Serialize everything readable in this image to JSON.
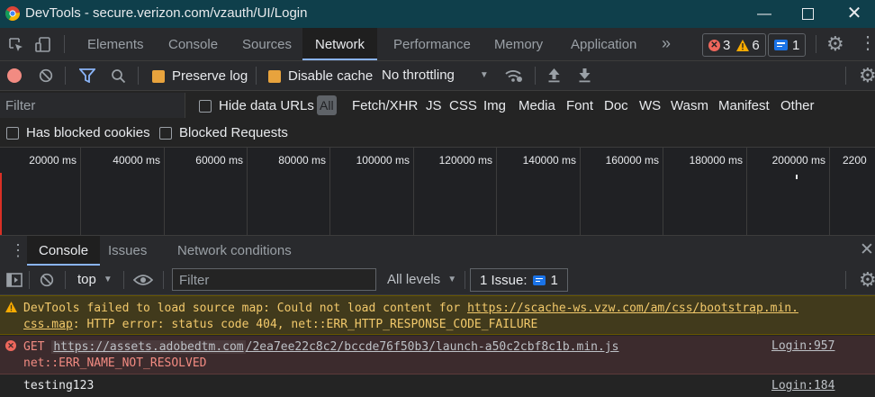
{
  "window": {
    "title": "DevTools - secure.verizon.com/vzauth/UI/Login"
  },
  "tabs": [
    {
      "label": "Elements"
    },
    {
      "label": "Console"
    },
    {
      "label": "Sources"
    },
    {
      "label": "Network"
    },
    {
      "label": "Performance"
    },
    {
      "label": "Memory"
    },
    {
      "label": "Application"
    }
  ],
  "badges": {
    "errors": "3",
    "warnings": "6",
    "messages": "1"
  },
  "network_toolbar": {
    "preserve_log": "Preserve log",
    "disable_cache": "Disable cache",
    "throttling": "No throttling"
  },
  "filter_row": {
    "placeholder": "Filter",
    "hide_data_urls": "Hide data URLs",
    "types": [
      "All",
      "Fetch/XHR",
      "JS",
      "CSS",
      "Img",
      "Media",
      "Font",
      "Doc",
      "WS",
      "Wasm",
      "Manifest",
      "Other"
    ]
  },
  "blocked_row": {
    "has_blocked_cookies": "Has blocked cookies",
    "blocked_requests": "Blocked Requests"
  },
  "timeline": {
    "ticks": [
      "20000 ms",
      "40000 ms",
      "60000 ms",
      "80000 ms",
      "100000 ms",
      "120000 ms",
      "140000 ms",
      "160000 ms",
      "180000 ms",
      "200000 ms",
      "2200"
    ]
  },
  "drawer": {
    "tabs": [
      {
        "label": "Console"
      },
      {
        "label": "Issues"
      },
      {
        "label": "Network conditions"
      }
    ]
  },
  "console_toolbar": {
    "context": "top",
    "filter_placeholder": "Filter",
    "levels": "All levels",
    "issues_label": "1 Issue:",
    "issues_count": "1"
  },
  "messages": {
    "warning": {
      "text_a": "DevTools failed to load source map: Could not load content for ",
      "link_a": "https://scache-ws.vzw.com/am/css/bootstrap.min.",
      "link_b": "css.map",
      "text_b": ": HTTP error: status code 404, net::ERR_HTTP_RESPONSE_CODE_FAILURE"
    },
    "error": {
      "method": "GET ",
      "url_host": "https://assets.adobedtm.com",
      "url_path": "/2ea7ee22c8c2/bccde76f50b3/launch-a50c2cbf8c1b.min.js",
      "code": "net::ERR_NAME_NOT_RESOLVED",
      "source": "Login:957"
    },
    "log": {
      "text": "testing123",
      "source": "Login:184"
    }
  },
  "colors": {
    "titlebar": "#0f3f4b",
    "accent": "#8ab4f8",
    "checkbox": "#e8a33d",
    "warning_bg": "#413a1c",
    "warning_text": "#f2c96b",
    "error_bg": "#3c2b2d",
    "error_text": "#f28b82"
  }
}
